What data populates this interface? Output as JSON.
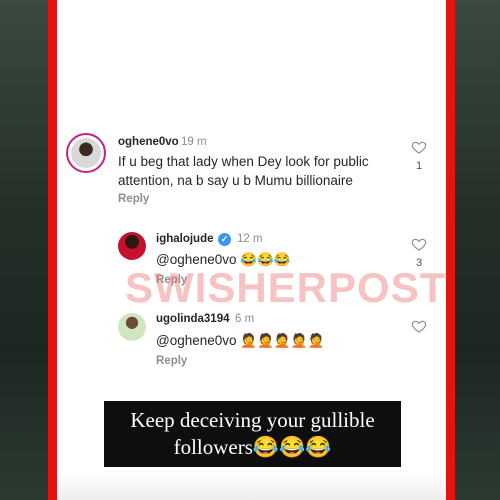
{
  "comments": [
    {
      "username": "oghene0vo",
      "time": "19 m",
      "text_line1": "If u beg that lady when Dey look for public",
      "text_line2": "attention, na b say u b Mumu billionaire",
      "reply_label": "Reply",
      "likes": "1",
      "avatar_icon": "user-avatar-story-ring"
    },
    {
      "username": "ighalojude",
      "time": "12 m",
      "text": "@oghene0vo 😂😂😂",
      "reply_label": "Reply",
      "likes": "3",
      "verified": true,
      "avatar_icon": "user-avatar-red-jersey"
    },
    {
      "username": "ugolinda3194",
      "time": "6 m",
      "text": "@oghene0vo 🤦🤦🤦🤦🤦",
      "reply_label": "Reply",
      "avatar_icon": "user-avatar-woman"
    }
  ],
  "watermark": "SWISHERPOST",
  "caption": {
    "line1": "Keep deceiving your gullible",
    "line2": "followers😂😂😂"
  },
  "colors": {
    "border_red": "#e3130f",
    "verified_blue": "#3897f0",
    "story_ring": "#c81f8b"
  }
}
